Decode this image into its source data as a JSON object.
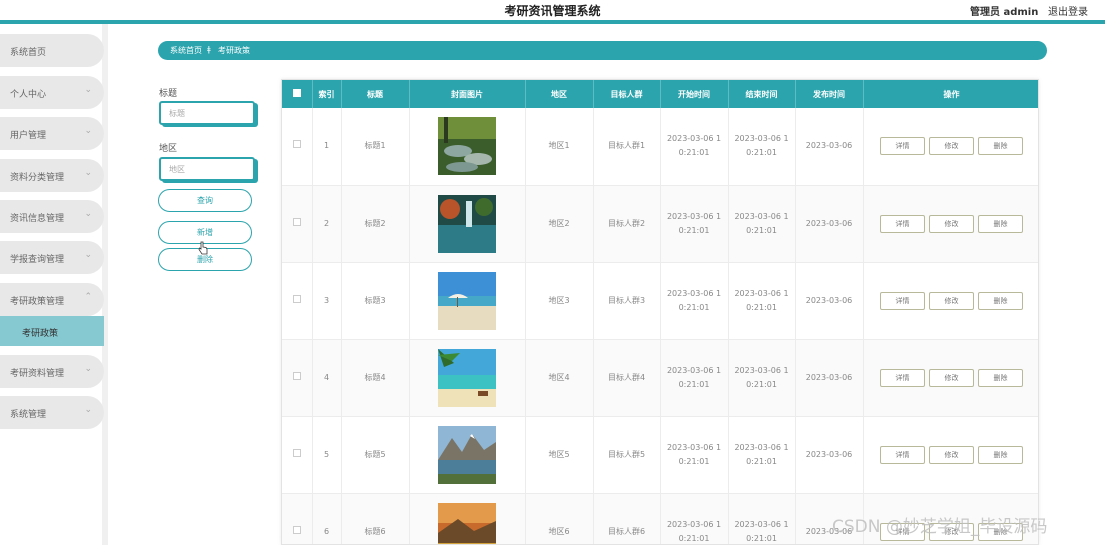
{
  "header": {
    "title": "考研资讯管理系统",
    "user": "管理员 admin",
    "logout": "退出登录"
  },
  "sidebar": {
    "items": [
      {
        "label": "系统首页",
        "chevron": ""
      },
      {
        "label": "个人中心",
        "chevron": "⌄"
      },
      {
        "label": "用户管理",
        "chevron": "⌄"
      },
      {
        "label": "资料分类管理",
        "chevron": "⌄"
      },
      {
        "label": "资讯信息管理",
        "chevron": "⌄"
      },
      {
        "label": "学报查询管理",
        "chevron": "⌄"
      },
      {
        "label": "考研政策管理",
        "chevron": "⌃"
      },
      {
        "label": "考研资料管理",
        "chevron": "⌄"
      },
      {
        "label": "系统管理",
        "chevron": "⌄"
      }
    ],
    "active_sub": "考研政策"
  },
  "breadcrumb": {
    "home": "系统首页",
    "separator": "ǂ",
    "current": "考研政策"
  },
  "search": {
    "title_label": "标题",
    "title_placeholder": "标题",
    "region_label": "地区",
    "region_placeholder": "地区",
    "query_button": "查询",
    "add_button": "新增",
    "delete_button": "删除"
  },
  "table": {
    "columns": [
      "",
      "索引",
      "标题",
      "封面图片",
      "地区",
      "目标人群",
      "开始时间",
      "结束时间",
      "发布时间",
      "操作"
    ],
    "rows": [
      {
        "index": "1",
        "title": "标题1",
        "image": "forest-stream",
        "region": "地区1",
        "target": "目标人群1",
        "start": "2023-03-06 1\n0:21:01",
        "end": "2023-03-06 1\n0:21:01",
        "publish": "2023-03-06"
      },
      {
        "index": "2",
        "title": "标题2",
        "image": "waterfall-lake",
        "region": "地区2",
        "target": "目标人群2",
        "start": "2023-03-06 1\n0:21:01",
        "end": "2023-03-06 1\n0:21:01",
        "publish": "2023-03-06"
      },
      {
        "index": "3",
        "title": "标题3",
        "image": "beach-umbrella",
        "region": "地区3",
        "target": "目标人群3",
        "start": "2023-03-06 1\n0:21:01",
        "end": "2023-03-06 1\n0:21:01",
        "publish": "2023-03-06"
      },
      {
        "index": "4",
        "title": "标题4",
        "image": "tropical-beach",
        "region": "地区4",
        "target": "目标人群4",
        "start": "2023-03-06 1\n0:21:01",
        "end": "2023-03-06 1\n0:21:01",
        "publish": "2023-03-06"
      },
      {
        "index": "5",
        "title": "标题5",
        "image": "mountain-lake",
        "region": "地区5",
        "target": "目标人群5",
        "start": "2023-03-06 1\n0:21:01",
        "end": "2023-03-06 1\n0:21:01",
        "publish": "2023-03-06"
      },
      {
        "index": "6",
        "title": "标题6",
        "image": "sunset-meadow",
        "region": "地区6",
        "target": "目标人群6",
        "start": "2023-03-06 1\n0:21:01",
        "end": "2023-03-06 1\n0:21:01",
        "publish": "2023-03-06"
      }
    ],
    "actions": {
      "detail": "详情",
      "edit": "修改",
      "delete": "删除"
    }
  },
  "watermark": "CSDN @妙芝学姐_毕设源码",
  "colors": {
    "accent": "#2ba4ad",
    "active_sub_bg": "#86c9d1"
  }
}
